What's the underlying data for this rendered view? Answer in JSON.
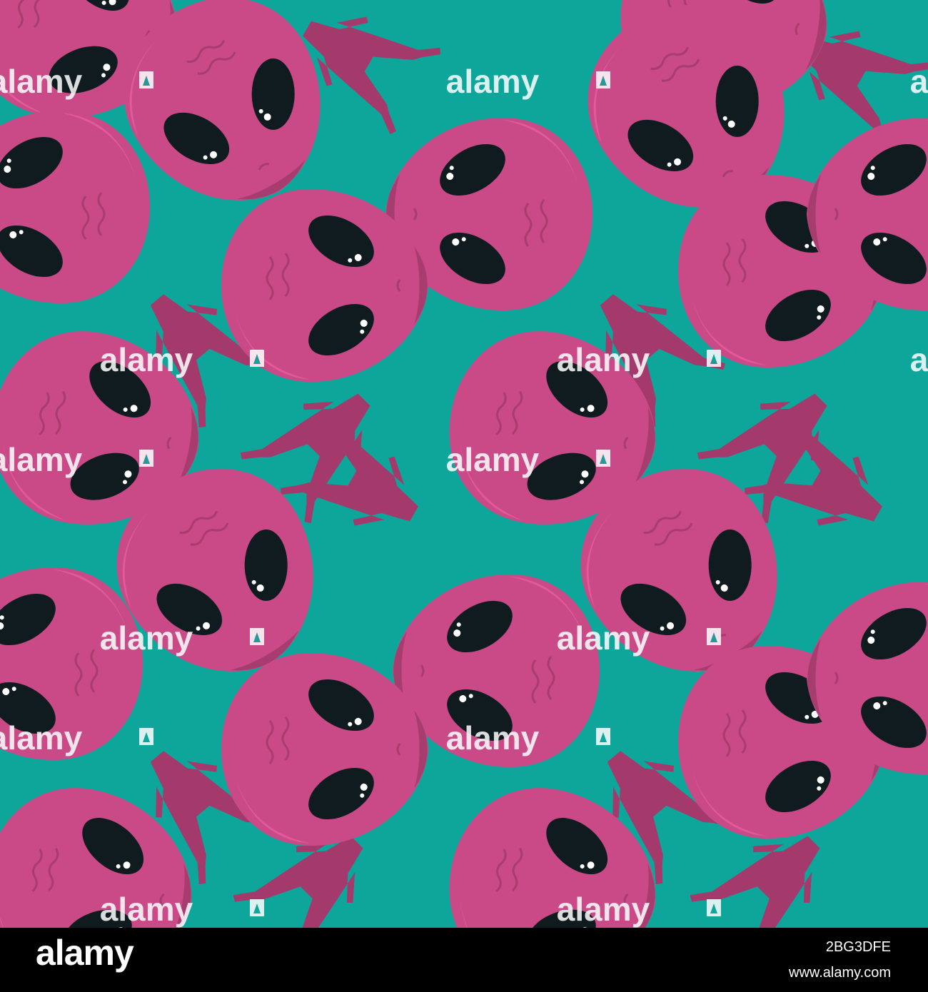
{
  "watermark": {
    "text": "alamy",
    "icon": "alamy-a-logo-icon"
  },
  "footer": {
    "logo_text": "alamy",
    "image_id": "2BG3DFE",
    "url": "www.alamy.com"
  },
  "colors": {
    "background": "#0ea59a",
    "head": "#c94a86",
    "head_shade": "#a73d6f",
    "head_highlight": "#e25a9b",
    "body": "#a43a6c",
    "eye": "#0f1b1f",
    "eye_shine": "#ffffff",
    "footer_bg": "#000000",
    "footer_text": "#ffffff"
  }
}
